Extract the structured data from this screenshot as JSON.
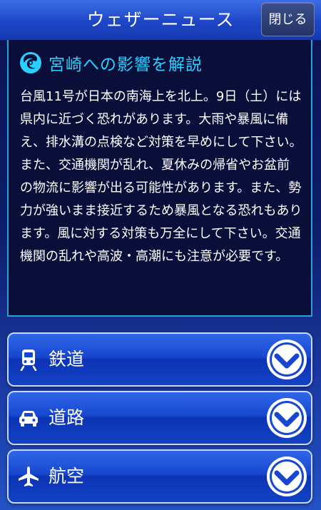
{
  "header": {
    "title": "ウェザーニュース",
    "close_label": "閉じる"
  },
  "explanation": {
    "title": "宮崎への影響を解説",
    "body": "台風11号が日本の南海上を北上。9日（土）には県内に近づく恐れがあります。大雨や暴風に備え、排水溝の点検など対策を早めにして下さい。また、交通機関が乱れ、夏休みの帰省やお盆前の物流に影響が出る可能性があります。また、勢力が強いまま接近するため暴風となる恐れもあります。風に対する対策も万全にして下さい。交通機関の乱れや高波・高潮にも注意が必要です。"
  },
  "categories": [
    {
      "label": "鉄道",
      "icon": "train-icon"
    },
    {
      "label": "道路",
      "icon": "car-icon"
    },
    {
      "label": "航空",
      "icon": "airplane-icon"
    }
  ],
  "colors": {
    "accent_cyan": "#2ad0ff",
    "header_blue": "#1e46c7",
    "panel_bg": "#0a0f3a",
    "button_blue": "#1747d0"
  }
}
